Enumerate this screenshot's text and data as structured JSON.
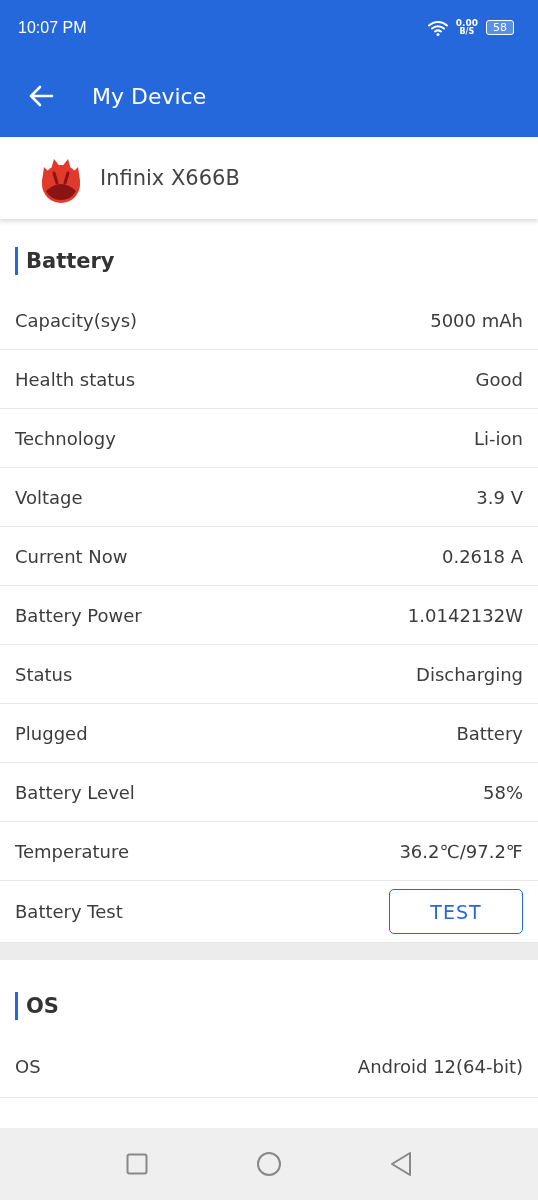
{
  "status_bar": {
    "time": "10:07 PM",
    "net_speed": "0.00",
    "net_unit": "B/S",
    "battery": "58"
  },
  "app_bar": {
    "title": "My Device"
  },
  "device": {
    "name": "Infinix X666B"
  },
  "sections": [
    {
      "title": "Battery",
      "rows": [
        {
          "kind": "text",
          "label": "Capacity(sys)",
          "value": "5000 mAh"
        },
        {
          "kind": "text",
          "label": "Health status",
          "value": "Good"
        },
        {
          "kind": "text",
          "label": "Technology",
          "value": "Li-ion"
        },
        {
          "kind": "text",
          "label": "Voltage",
          "value": "3.9 V"
        },
        {
          "kind": "text",
          "label": "Current Now",
          "value": "0.2618 A"
        },
        {
          "kind": "text",
          "label": "Battery Power",
          "value": "1.0142132W"
        },
        {
          "kind": "text",
          "label": "Status",
          "value": "Discharging"
        },
        {
          "kind": "text",
          "label": "Plugged",
          "value": "Battery"
        },
        {
          "kind": "text",
          "label": "Battery Level",
          "value": "58%"
        },
        {
          "kind": "text",
          "label": "Temperature",
          "value": "36.2℃/97.2℉"
        },
        {
          "kind": "button",
          "label": "Battery Test",
          "value": "TEST"
        }
      ]
    },
    {
      "title": "OS",
      "rows": [
        {
          "kind": "text",
          "label": "OS",
          "value": "Android 12(64-bit)"
        }
      ]
    }
  ]
}
